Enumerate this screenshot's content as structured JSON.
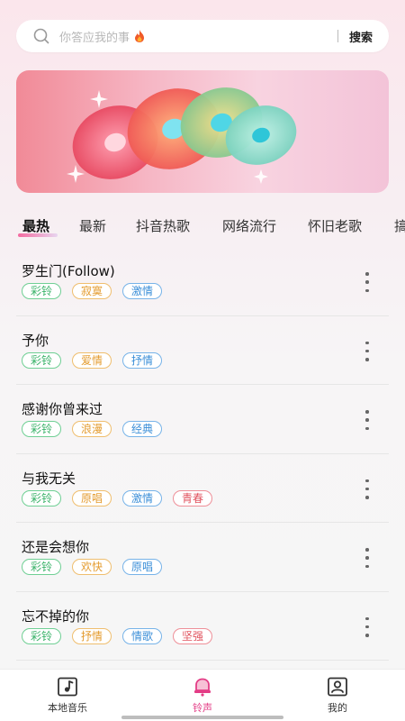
{
  "search": {
    "placeholder": "你答应我的事",
    "button_label": "搜索",
    "flame_icon": "flame-icon"
  },
  "banner": {
    "image": "colorful-vinyl-records-illustration",
    "colors": [
      "#f18a97",
      "#f6b6c4",
      "#f8d3e0"
    ]
  },
  "tabs": [
    {
      "label": "最热",
      "active": true
    },
    {
      "label": "最新"
    },
    {
      "label": "抖音热歌"
    },
    {
      "label": "网络流行"
    },
    {
      "label": "怀旧老歌"
    },
    {
      "label": "搞"
    }
  ],
  "songs": [
    {
      "title": "罗生门(Follow)",
      "tags": [
        {
          "text": "彩铃",
          "color": "green"
        },
        {
          "text": "寂寞",
          "color": "orange"
        },
        {
          "text": "激情",
          "color": "blue"
        }
      ]
    },
    {
      "title": "予你",
      "tags": [
        {
          "text": "彩铃",
          "color": "green"
        },
        {
          "text": "爱情",
          "color": "orange"
        },
        {
          "text": "抒情",
          "color": "blue"
        }
      ]
    },
    {
      "title": "感谢你曾来过",
      "tags": [
        {
          "text": "彩铃",
          "color": "green"
        },
        {
          "text": "浪漫",
          "color": "orange"
        },
        {
          "text": "经典",
          "color": "blue"
        }
      ]
    },
    {
      "title": "与我无关",
      "tags": [
        {
          "text": "彩铃",
          "color": "green"
        },
        {
          "text": "原唱",
          "color": "orange"
        },
        {
          "text": "激情",
          "color": "blue"
        },
        {
          "text": "青春",
          "color": "red"
        }
      ]
    },
    {
      "title": "还是会想你",
      "tags": [
        {
          "text": "彩铃",
          "color": "green"
        },
        {
          "text": "欢快",
          "color": "orange"
        },
        {
          "text": "原唱",
          "color": "blue"
        }
      ]
    },
    {
      "title": "忘不掉的你",
      "tags": [
        {
          "text": "彩铃",
          "color": "green"
        },
        {
          "text": "抒情",
          "color": "orange"
        },
        {
          "text": "情歌",
          "color": "blue"
        },
        {
          "text": "坚强",
          "color": "red"
        }
      ]
    }
  ],
  "nav": [
    {
      "label": "本地音乐",
      "icon": "music-note-icon",
      "active": false
    },
    {
      "label": "铃声",
      "icon": "bell-icon",
      "active": true
    },
    {
      "label": "我的",
      "icon": "profile-icon",
      "active": false
    }
  ],
  "colors": {
    "accent": "#e33d86",
    "tag_green": "#3bb36a",
    "tag_orange": "#e49c30",
    "tag_blue": "#3c8fd8",
    "tag_red": "#e0525e"
  }
}
